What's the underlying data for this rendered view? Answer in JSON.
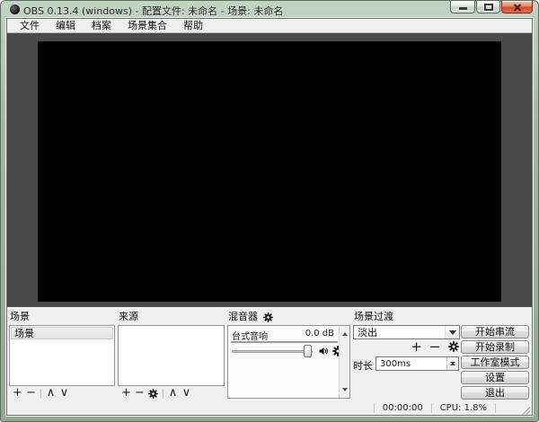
{
  "window": {
    "title": "OBS 0.13.4 (windows) - 配置文件: 未命名 - 场景: 未命名"
  },
  "menu": {
    "items": [
      "文件",
      "编辑",
      "档案",
      "场景集合",
      "帮助"
    ]
  },
  "panels": {
    "scenes": {
      "label": "场景",
      "items": [
        "场景"
      ]
    },
    "sources": {
      "label": "来源",
      "items": []
    },
    "mixer": {
      "label": "混音器",
      "source_name": "台式音响",
      "volume_db": "0.0 dB"
    },
    "transitions": {
      "label": "场景过渡",
      "selected": "淡出",
      "duration_label": "时长",
      "duration_value": "300ms"
    }
  },
  "icons": {
    "add": "+",
    "remove": "−",
    "move_up": "∧",
    "move_down": "∨"
  },
  "actions": {
    "start_streaming": "开始串流",
    "start_recording": "开始录制",
    "studio_mode": "工作室模式",
    "settings": "设置",
    "exit": "退出"
  },
  "status": {
    "time": "00:00:00",
    "cpu": "CPU: 1.8%"
  },
  "colors": {
    "frame_green": "#a3b7a3",
    "titlebar_top": "#eef4ee",
    "close_red": "#cc4c2c",
    "preview_bg": "#4a4a4a",
    "canvas_black": "#000000",
    "dock_bg": "#f0f0f0"
  }
}
